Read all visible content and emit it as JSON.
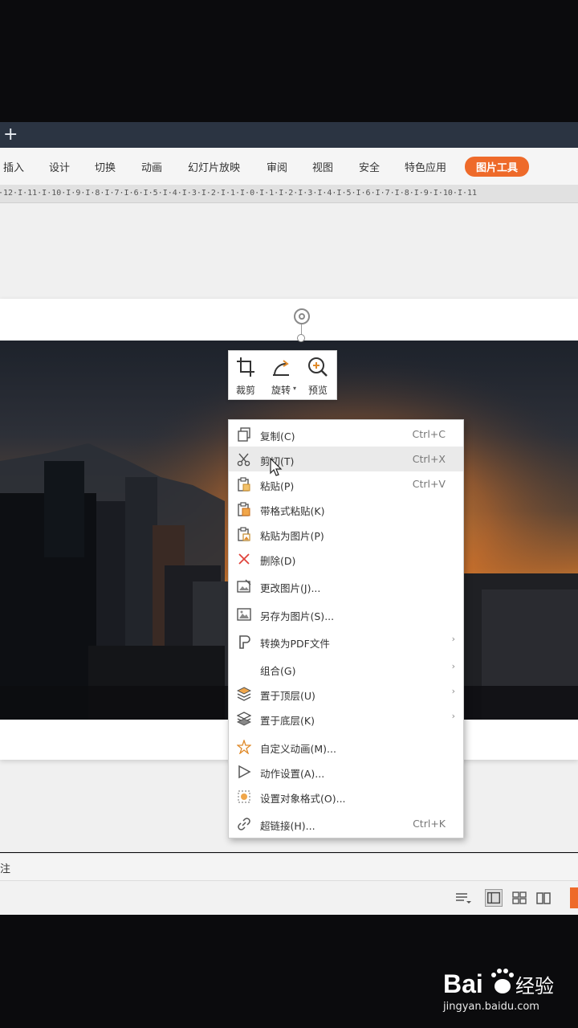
{
  "tabstrip": {
    "new_tab_symbol": "+"
  },
  "menubar": {
    "items": [
      "插入",
      "设计",
      "切换",
      "动画",
      "幻灯片放映",
      "审阅",
      "视图",
      "安全",
      "特色应用"
    ],
    "active_tool": "图片工具",
    "accent": "#ee6a2a"
  },
  "ruler": {
    "text": "·12·I·11·I·10·I·9·I·8·I·7·I·6·I·5·I·4·I·3·I·2·I·1·I·0·I·1·I·2·I·3·I·4·I·5·I·6·I·7·I·8·I·9·I·10·I·11"
  },
  "minibar": [
    {
      "label": "裁剪",
      "icon": "crop-icon"
    },
    {
      "label": "旋转",
      "icon": "rotate-icon",
      "has_dropdown": true
    },
    {
      "label": "预览",
      "icon": "zoom-preview-icon"
    }
  ],
  "context_menu": [
    {
      "label": "复制(C)",
      "shortcut": "Ctrl+C",
      "icon": "copy-icon"
    },
    {
      "label": "剪切(T)",
      "shortcut": "Ctrl+X",
      "icon": "scissors-icon",
      "highlighted": true
    },
    {
      "label": "粘贴(P)",
      "shortcut": "Ctrl+V",
      "icon": "paste-icon"
    },
    {
      "label": "带格式粘贴(K)",
      "shortcut": "",
      "icon": "paste-format-icon"
    },
    {
      "label": "粘贴为图片(P)",
      "shortcut": "",
      "icon": "paste-image-icon"
    },
    {
      "label": "删除(D)",
      "shortcut": "",
      "icon": "delete-icon"
    },
    {
      "label": "更改图片(J)...",
      "shortcut": "",
      "icon": "change-picture-icon"
    },
    {
      "label": "另存为图片(S)...",
      "shortcut": "",
      "icon": "save-picture-icon"
    },
    {
      "label": "转换为PDF文件",
      "shortcut": "",
      "icon": "pdf-icon",
      "submenu": true
    },
    {
      "label": "组合(G)",
      "shortcut": "",
      "icon": "",
      "submenu": true
    },
    {
      "label": "置于顶层(U)",
      "shortcut": "",
      "icon": "bring-front-icon",
      "submenu": true
    },
    {
      "label": "置于底层(K)",
      "shortcut": "",
      "icon": "send-back-icon",
      "submenu": true
    },
    {
      "label": "自定义动画(M)...",
      "shortcut": "",
      "icon": "animation-icon"
    },
    {
      "label": "动作设置(A)...",
      "shortcut": "",
      "icon": "action-play-icon"
    },
    {
      "label": "设置对象格式(O)...",
      "shortcut": "",
      "icon": "format-object-icon"
    },
    {
      "label": "超链接(H)...",
      "shortcut": "Ctrl+K",
      "icon": "hyperlink-icon"
    }
  ],
  "notes": {
    "label": "注"
  },
  "statusbar": {
    "icons": [
      "notes-toggle-icon",
      "normal-view-icon",
      "slide-sorter-icon",
      "reading-view-icon"
    ]
  },
  "watermark": {
    "brand": "Bai经验",
    "url": "jingyan.baidu.com"
  }
}
